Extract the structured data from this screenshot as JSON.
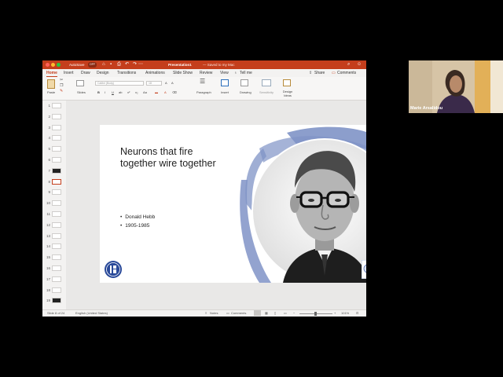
{
  "app": {
    "autosave_label": "AutoSave",
    "autosave_state": "OFF",
    "document_title": "Presentation1",
    "save_status": "— Saved to my Mac"
  },
  "menu_tabs": [
    {
      "label": "Home",
      "active": true
    },
    {
      "label": "Insert"
    },
    {
      "label": "Draw"
    },
    {
      "label": "Design"
    },
    {
      "label": "Transitions"
    },
    {
      "label": "Animations"
    },
    {
      "label": "Slide Show"
    },
    {
      "label": "Review"
    },
    {
      "label": "View"
    },
    {
      "label": "Tell me"
    }
  ],
  "header_actions": {
    "share": "Share",
    "comments": "Comments"
  },
  "ribbon": {
    "paste": "Paste",
    "slides": "Slides",
    "font_name": "Calibri (Body)",
    "font_size": "18",
    "paragraph": "Paragraph",
    "insert": "Insert",
    "drawing": "Drawing",
    "sensitivity": "Sensitivity",
    "design_ideas": "Design Ideas"
  },
  "thumbnails": [
    "1",
    "2",
    "3",
    "4",
    "5",
    "6",
    "7",
    "8",
    "9",
    "10",
    "11",
    "12",
    "13",
    "14",
    "15",
    "16",
    "17",
    "18",
    "19"
  ],
  "selected_slide": "8",
  "slide": {
    "title": "Neurons that fire\ntogether wire together",
    "bullets": [
      "Donald Hebb",
      "1905-1985"
    ]
  },
  "statusbar": {
    "slide_info": "Slide 8 of 24",
    "language": "English (United States)",
    "notes": "Notes",
    "comments": "Comments",
    "zoom": "101%"
  },
  "webcam": {
    "name": "Marie Arsalidou"
  },
  "colors": {
    "accent": "#c43e1c",
    "frame_blue": "#7f93c6",
    "logo_blue": "#2a4a9a"
  }
}
